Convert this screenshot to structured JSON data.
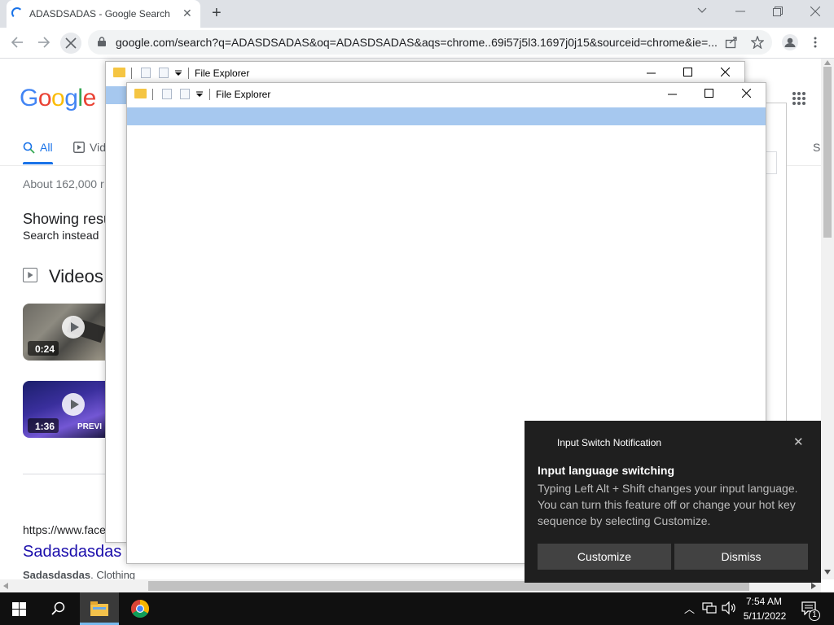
{
  "browser": {
    "tab_title": "ADASDSADAS - Google Search",
    "tab_close": "✕",
    "new_tab": "+",
    "url": "google.com/search?q=ADASDSADAS&oq=ADASDSADAS&aqs=chrome..69i57j5l3.1697j0j15&sourceid=chrome&ie=..."
  },
  "google": {
    "logo": [
      "G",
      "o",
      "o",
      "g",
      "l",
      "e"
    ],
    "logo_colors": [
      "#4285f4",
      "#ea4335",
      "#fbbc05",
      "#4285f4",
      "#34a853",
      "#ea4335"
    ],
    "tabs": [
      {
        "label": "All",
        "active": true
      },
      {
        "label": "Vid",
        "active": false
      }
    ],
    "right_clipped_tab": "S",
    "result_stats": "About 162,000 r",
    "showing_results": "Showing resu",
    "search_instead": "Search instead",
    "videos_heading": "Videos",
    "videos": [
      {
        "duration": "0:24",
        "icon": "play-icon"
      },
      {
        "duration": "1:36",
        "overlay_text": "PREVI",
        "icon": "play-icon"
      }
    ],
    "result": {
      "url": "https://www.face",
      "title": "Sadasdasdas",
      "snippet_bold": "Sadasdasdas",
      "snippet_rest": ". Clothing"
    }
  },
  "file_explorer_back": {
    "title": "File Explorer"
  },
  "file_explorer_front": {
    "title": "File Explorer"
  },
  "notification": {
    "app_name": "Input Switch Notification",
    "close": "✕",
    "title": "Input language switching",
    "body": "Typing Left Alt + Shift changes your input language. You can turn this feature off or change your hot key sequence by selecting Customize.",
    "buttons": [
      "Customize",
      "Dismiss"
    ]
  },
  "taskbar": {
    "time": "7:54 AM",
    "date": "5/11/2022",
    "tray_chevron": "︿",
    "notification_count": "1"
  }
}
